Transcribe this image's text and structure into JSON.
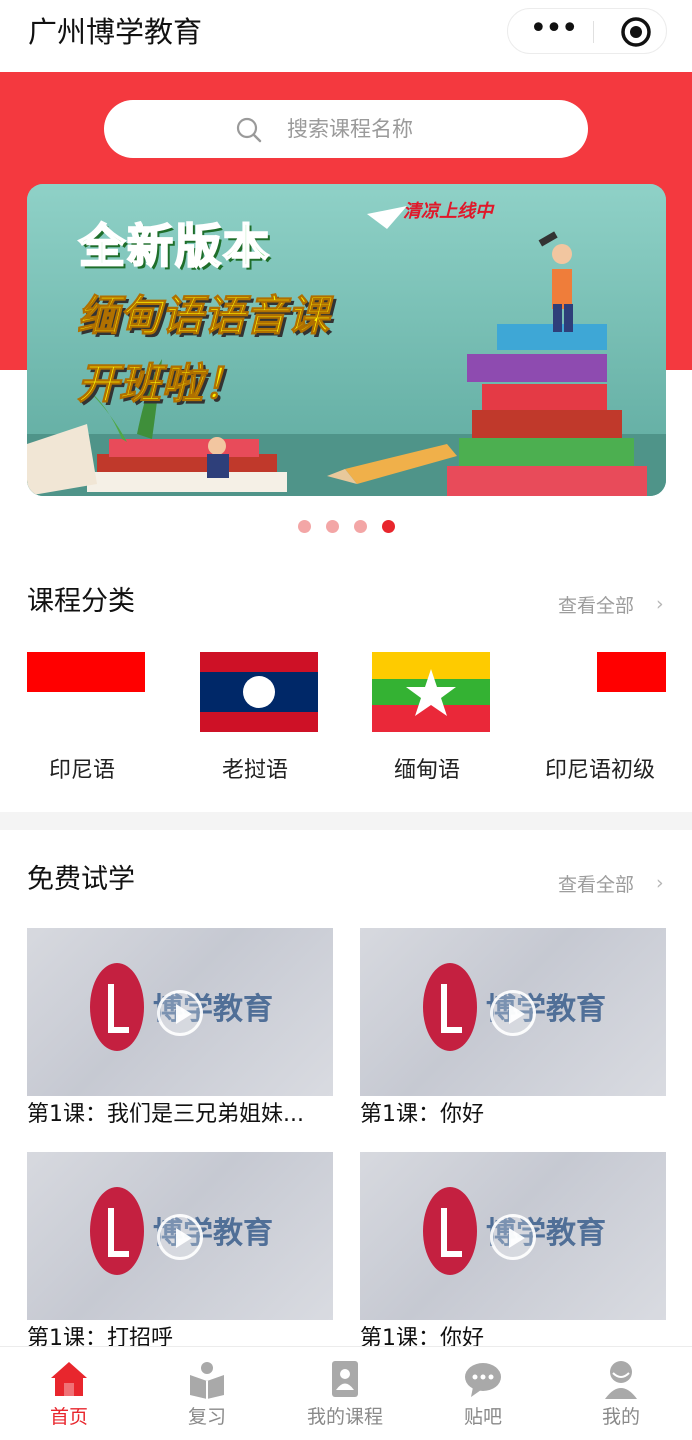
{
  "app": {
    "title": "广州博学教育",
    "menu_glyph": "•••"
  },
  "search": {
    "placeholder": "搜索课程名称"
  },
  "banner": {
    "headline": "全新版本",
    "line2": "缅甸语语音课",
    "line3": "开班啦！",
    "tag": "清凉上线中",
    "slide_count": 4,
    "active_slide": 4
  },
  "categories": {
    "title": "课程分类",
    "more": "查看全部",
    "more_chevron": "›",
    "items": [
      {
        "label": "印尼语",
        "flag": "indonesia-flag"
      },
      {
        "label": "老挝语",
        "flag": "laos-flag"
      },
      {
        "label": "缅甸语",
        "flag": "myanmar-flag"
      },
      {
        "label": "印尼语初级",
        "flag": "indonesia-flag"
      }
    ]
  },
  "free_trial": {
    "title": "免费试学",
    "more": "查看全部",
    "more_chevron": "›",
    "thumb_brand": "博学教育",
    "cards": [
      {
        "title": "第1课：我们是三兄弟姐妹..."
      },
      {
        "title": "第1课：你好"
      },
      {
        "title": "第1课：打招呼"
      },
      {
        "title": "第1课：你好"
      }
    ]
  },
  "tabbar": {
    "active": 0,
    "items": [
      {
        "label": "首页",
        "icon": "home-icon"
      },
      {
        "label": "复习",
        "icon": "review-icon"
      },
      {
        "label": "我的课程",
        "icon": "my-courses-icon"
      },
      {
        "label": "贴吧",
        "icon": "forum-icon"
      },
      {
        "label": "我的",
        "icon": "profile-icon"
      }
    ]
  },
  "colors": {
    "brand_red": "#f4393f",
    "active_red": "#e8262d",
    "muted_text": "#9d9d9d"
  }
}
